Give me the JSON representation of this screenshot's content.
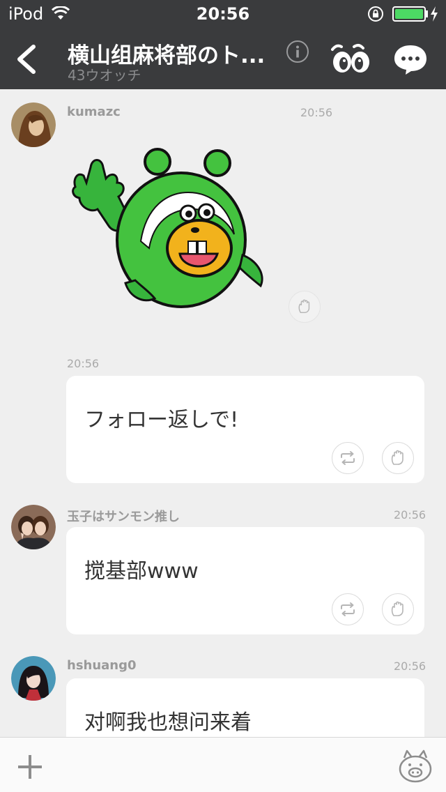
{
  "status_bar": {
    "carrier": "iPod",
    "time": "20:56",
    "battery_color": "#4cd964"
  },
  "header": {
    "title": "横山组麻将部のト...",
    "subtitle": "43ウオッチ",
    "icons": [
      "back-icon",
      "info-icon",
      "eyes-icon",
      "chat-icon"
    ]
  },
  "messages": [
    {
      "username": "kumazc",
      "time": "20:56",
      "type": "sticker"
    },
    {
      "time": "20:56",
      "text": "フォロー返しで!"
    },
    {
      "username": "玉子はサンモン推し",
      "time": "20:56",
      "text": "搅基部www"
    },
    {
      "username": "hshuang0",
      "time": "20:56",
      "text": "对啊我也想问来着"
    }
  ],
  "bottom_bar": {
    "icons": [
      "plus-icon",
      "pig-sticker-icon"
    ]
  }
}
